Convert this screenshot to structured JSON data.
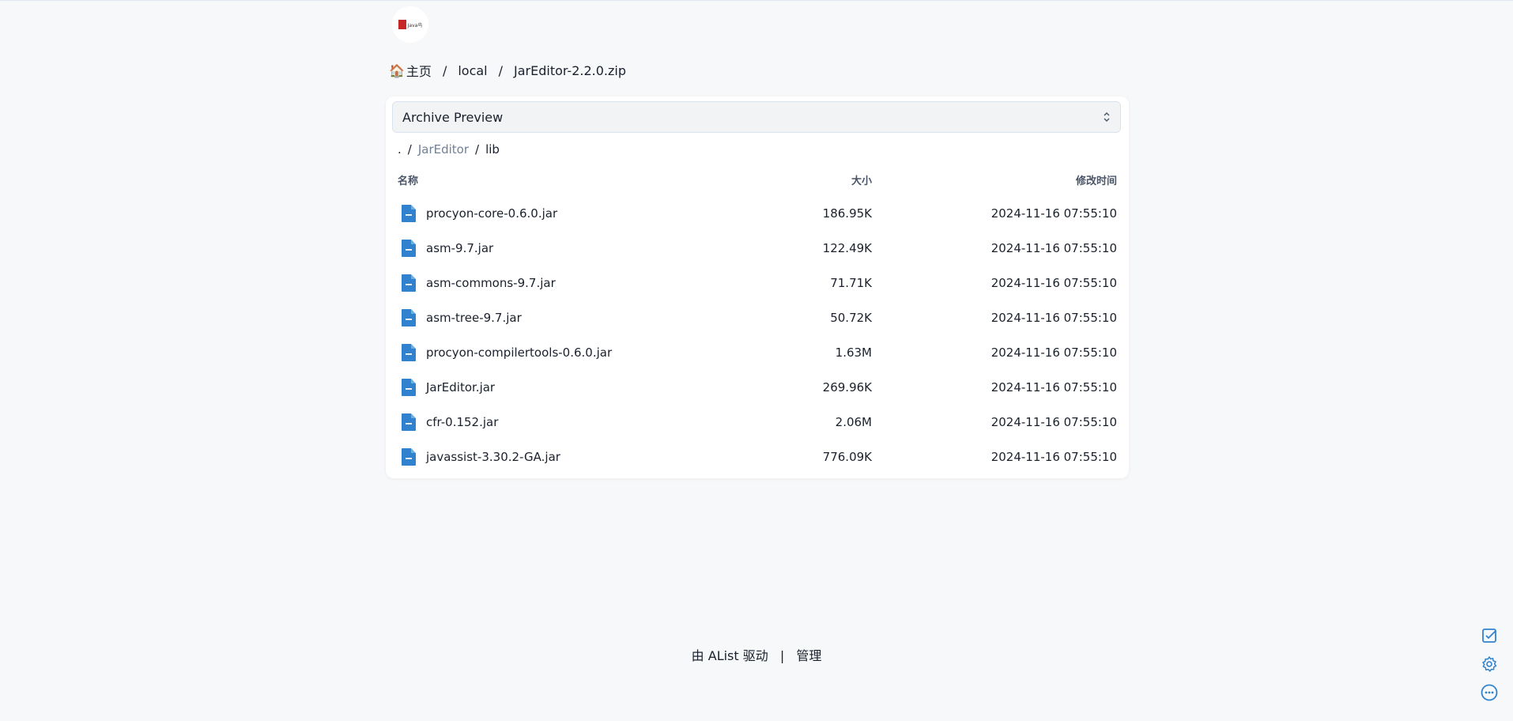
{
  "logo": {
    "text": "Java鸟"
  },
  "breadcrumb": {
    "home_label": "主页",
    "items": [
      "local",
      "JarEditor-2.2.0.zip"
    ],
    "separator": "/"
  },
  "preview": {
    "selected": "Archive Preview"
  },
  "path": {
    "root": ".",
    "items": [
      "JarEditor",
      "lib"
    ],
    "separator": "/"
  },
  "table": {
    "headers": {
      "name": "名称",
      "size": "大小",
      "modified": "修改时间"
    },
    "rows": [
      {
        "name": "procyon-core-0.6.0.jar",
        "size": "186.95K",
        "modified": "2024-11-16 07:55:10"
      },
      {
        "name": "asm-9.7.jar",
        "size": "122.49K",
        "modified": "2024-11-16 07:55:10"
      },
      {
        "name": "asm-commons-9.7.jar",
        "size": "71.71K",
        "modified": "2024-11-16 07:55:10"
      },
      {
        "name": "asm-tree-9.7.jar",
        "size": "50.72K",
        "modified": "2024-11-16 07:55:10"
      },
      {
        "name": "procyon-compilertools-0.6.0.jar",
        "size": "1.63M",
        "modified": "2024-11-16 07:55:10"
      },
      {
        "name": "JarEditor.jar",
        "size": "269.96K",
        "modified": "2024-11-16 07:55:10"
      },
      {
        "name": "cfr-0.152.jar",
        "size": "2.06M",
        "modified": "2024-11-16 07:55:10"
      },
      {
        "name": "javassist-3.30.2-GA.jar",
        "size": "776.09K",
        "modified": "2024-11-16 07:55:10"
      }
    ]
  },
  "footer": {
    "powered_by": "由 AList 驱动",
    "separator": "|",
    "manage": "管理"
  },
  "colors": {
    "accent": "#3182ce",
    "file_icon": "#3182ce",
    "background": "#f7f8fa"
  },
  "icons": {
    "home": "house-icon",
    "file": "file-icon",
    "select_arrow": "chevron-updown-icon",
    "side": [
      "checkbox-icon",
      "gear-icon",
      "more-icon"
    ]
  }
}
